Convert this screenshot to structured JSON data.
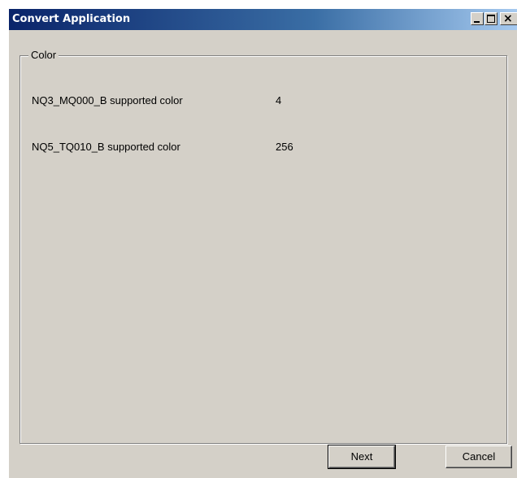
{
  "window": {
    "title": "Convert Application",
    "close_glyph": "×",
    "controls": [
      "minimize-icon",
      "maximize-icon",
      "close-icon"
    ]
  },
  "group": {
    "label": "Color",
    "rows": [
      {
        "label": "NQ3_MQ000_B supported color",
        "value": "4"
      },
      {
        "label": "NQ5_TQ010_B supported color",
        "value": "256"
      }
    ]
  },
  "buttons": {
    "next": "Next",
    "cancel": "Cancel"
  },
  "colors": {
    "title_start": "#0a246a",
    "title_end": "#a6caf0",
    "face": "#d4d0c8"
  }
}
